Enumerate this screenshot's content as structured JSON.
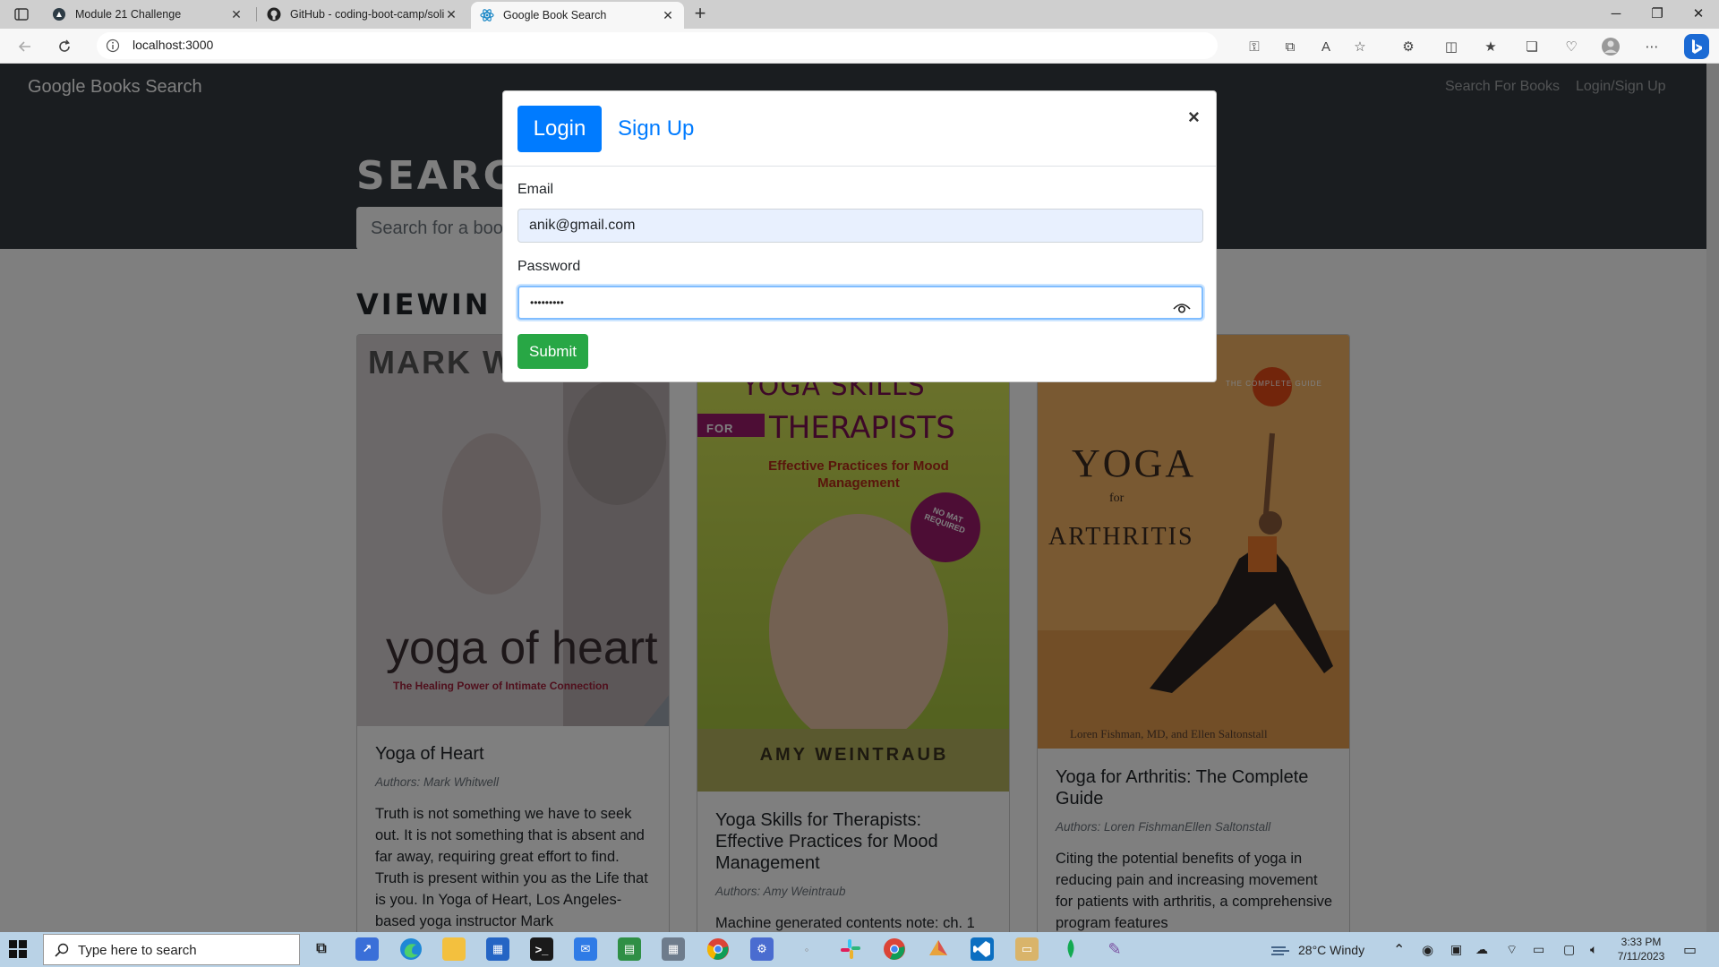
{
  "browser": {
    "tabs": [
      {
        "title": "Module 21 Challenge",
        "icon": "canvas-icon"
      },
      {
        "title": "GitHub - coding-boot-camp/soli",
        "icon": "github-icon"
      },
      {
        "title": "Google Book Search",
        "icon": "react-icon"
      }
    ],
    "close_glyph": "✕",
    "new_tab_glyph": "+",
    "url": "localhost:3000"
  },
  "navbar": {
    "brand": "Google Books Search",
    "links": [
      "Search For Books",
      "Login/Sign Up"
    ]
  },
  "hero": {
    "title": "SEARC",
    "search_placeholder": "Search for a boo"
  },
  "results_heading": "VIEWIN",
  "books": [
    {
      "title": "Yoga of Heart",
      "authors": "Authors: Mark Whitwell",
      "description": "Truth is not something we have to seek out. It is not something that is absent and far away, requiring great effort to find. Truth is present within you as the Life that is you. In Yoga of Heart, Los Angeles-based yoga instructor Mark",
      "cover": {
        "top": "MARK W",
        "main": "yoga of heart",
        "sub": "The Healing Power of Intimate Connection",
        "color": "#cfc9cc"
      }
    },
    {
      "title": "Yoga Skills for Therapists: Effective Practices for Mood Management",
      "authors": "Authors: Amy Weintraub",
      "description": "Machine generated contents note: ch. 1",
      "cover": {
        "top": "YOGA SKILLS",
        "main": "THERAPISTS",
        "for": "FOR",
        "sub": "Effective Practices for Mood Management",
        "badge": "NO MAT REQUIRED",
        "author": "AMY WEINTRAUB",
        "color": "#c9d94a"
      }
    },
    {
      "title": "Yoga for Arthritis: The Complete Guide",
      "authors": "Authors: Loren FishmanEllen Saltonstall",
      "description": "Citing the potential benefits of yoga in reducing pain and increasing movement for patients with arthritis, a comprehensive program features",
      "cover": {
        "top": "THE COMPLETE GUIDE",
        "main": "YOGA",
        "for": "for",
        "sub": "ARTHRITIS",
        "author": "Loren Fishman, MD, and Ellen Saltonstall",
        "color": "#e9a552"
      }
    }
  ],
  "modal": {
    "tab_login": "Login",
    "tab_signup": "Sign Up",
    "close": "×",
    "email_label": "Email",
    "email_value": "anik@gmail.com",
    "password_label": "Password",
    "password_mask": "•••••••••",
    "submit": "Submit"
  },
  "taskbar": {
    "search_placeholder": "Type here to search",
    "weather": "28°C  Windy",
    "time": "3:33 PM",
    "date": "7/11/2023"
  },
  "colors": {
    "primary": "#007bff",
    "success": "#28a745",
    "navbar": "#343a40"
  }
}
